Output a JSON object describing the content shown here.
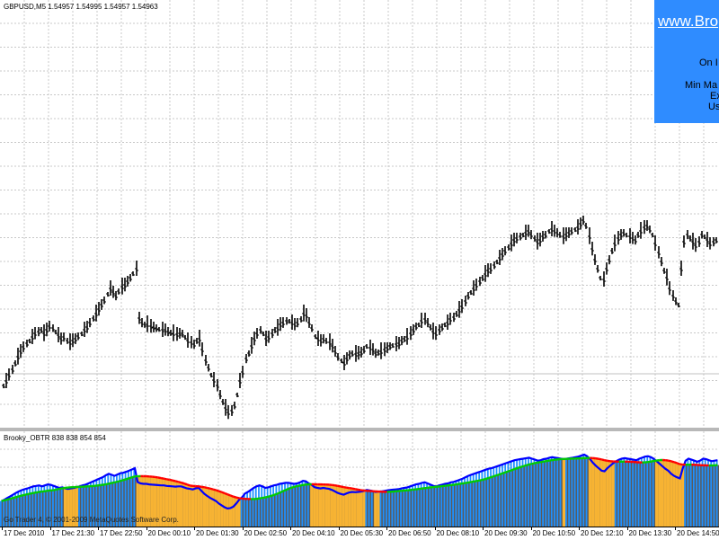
{
  "main_chart": {
    "title": "GBPUSD,M5  1.54957 1.54995 1.54957 1.54963"
  },
  "info_panel": {
    "site": "www.Bro",
    "line1": "On I",
    "line2": "Min Ma",
    "line3": "Ex",
    "line4": "Us"
  },
  "indicator": {
    "title": "Brooky_OBTR 838 838 854 854",
    "copyright": "Go Trader 4, © 2001-2009 MetaQuotes Software Corp."
  },
  "time_axis": {
    "labels": [
      "17 Dec 2010",
      "17 Dec 21:30",
      "17 Dec 22:50",
      "20 Dec 00:10",
      "20 Dec 01:30",
      "20 Dec 02:50",
      "20 Dec 04:10",
      "20 Dec 05:30",
      "20 Dec 06:50",
      "20 Dec 08:10",
      "20 Dec 09:30",
      "20 Dec 10:50",
      "20 Dec 12:10",
      "20 Dec 13:30",
      "20 Dec 14:50",
      "20 Dec 1"
    ]
  },
  "colors": {
    "grid": "#c8c8c8",
    "bars": "#000000",
    "up_blue": "#1e90ff",
    "line_blue": "#0000ff",
    "line_green": "#00cc00",
    "line_red": "#ff0000",
    "dark_gray": "#5a5a5a",
    "orange": "#f7b333",
    "panel_blue": "#2f8cff"
  },
  "chart_data": {
    "type": "line",
    "title": "",
    "xlabel": "",
    "ylabel": "",
    "series": [
      {
        "values": [
          430,
          425,
          418,
          412,
          405,
          398,
          392,
          387,
          383,
          380,
          376,
          372,
          370,
          368,
          372,
          368,
          364,
          366,
          370,
          374,
          378,
          376,
          380,
          382,
          380,
          378,
          375,
          372,
          368,
          365,
          360,
          355,
          350,
          345,
          340,
          335,
          328,
          322,
          326,
          330,
          325,
          320,
          318,
          314,
          310,
          305,
          300,
          355,
          360,
          362,
          362,
          364,
          365,
          366,
          367,
          368,
          368,
          370,
          371,
          372,
          373,
          372,
          372,
          376,
          380,
          382,
          384,
          380,
          378,
          390,
          402,
          410,
          418,
          424,
          430,
          440,
          448,
          455,
          460,
          458,
          452,
          440,
          425,
          415,
          400,
          394,
          386,
          378,
          372,
          368,
          372,
          378,
          376,
          372,
          368,
          366,
          362,
          360,
          358,
          358,
          360,
          362,
          360,
          356,
          350,
          352,
          360,
          366,
          375,
          378,
          380,
          378,
          380,
          382,
          386,
          392,
          398,
          402,
          405,
          400,
          396,
          394,
          395,
          394,
          393,
          390,
          386,
          388,
          390,
          394,
          393,
          392,
          390,
          388,
          386,
          385,
          384,
          383,
          380,
          378,
          376,
          372,
          368,
          364,
          362,
          358,
          356,
          360,
          365,
          370,
          372,
          368,
          365,
          362,
          360,
          356,
          354,
          350,
          346,
          342,
          336,
          330,
          326,
          322,
          318,
          314,
          310,
          306,
          302,
          300,
          296,
          292,
          288,
          284,
          280,
          276,
          272,
          268,
          266,
          264,
          262,
          260,
          258,
          262,
          266,
          270,
          268,
          264,
          262,
          258,
          256,
          258,
          260,
          262,
          264,
          262,
          260,
          258,
          256,
          254,
          250,
          246,
          252,
          264,
          278,
          290,
          300,
          310,
          312,
          300,
          290,
          280,
          272,
          266,
          262,
          260,
          262,
          264,
          266,
          268,
          262,
          258,
          254,
          252,
          256,
          262,
          272,
          282,
          292,
          302,
          310,
          322,
          330,
          336,
          340,
          300,
          270,
          262,
          266,
          270,
          274,
          270,
          262,
          264,
          268,
          272,
          270,
          268
        ],
        "indicator_note": ""
      }
    ]
  }
}
